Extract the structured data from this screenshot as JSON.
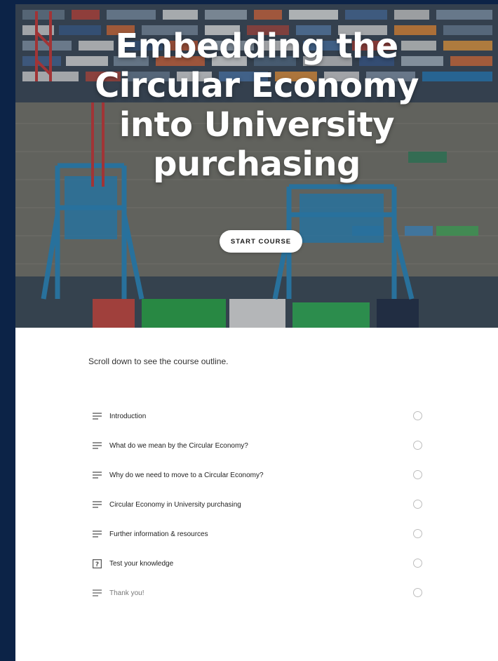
{
  "hero": {
    "title": "Embedding the Circular Economy into University purchasing",
    "start_label": "START COURSE"
  },
  "intro_text": "Scroll down to see the course outline.",
  "outline": [
    {
      "label": "Introduction",
      "icon": "lines-icon"
    },
    {
      "label": "What do we mean by the Circular Economy?",
      "icon": "lines-icon"
    },
    {
      "label": "Why do we need to move to a Circular Economy?",
      "icon": "lines-icon"
    },
    {
      "label": "Circular Economy in University purchasing",
      "icon": "lines-icon"
    },
    {
      "label": "Further information & resources",
      "icon": "lines-icon"
    },
    {
      "label": "Test your knowledge",
      "icon": "quiz-icon"
    },
    {
      "label": "Thank you!",
      "icon": "lines-icon"
    }
  ],
  "colors": {
    "sidebar": "#0c2347",
    "page": "#ffffff",
    "crane": "#2f86b8",
    "status_circle": "#bdbdbd"
  }
}
